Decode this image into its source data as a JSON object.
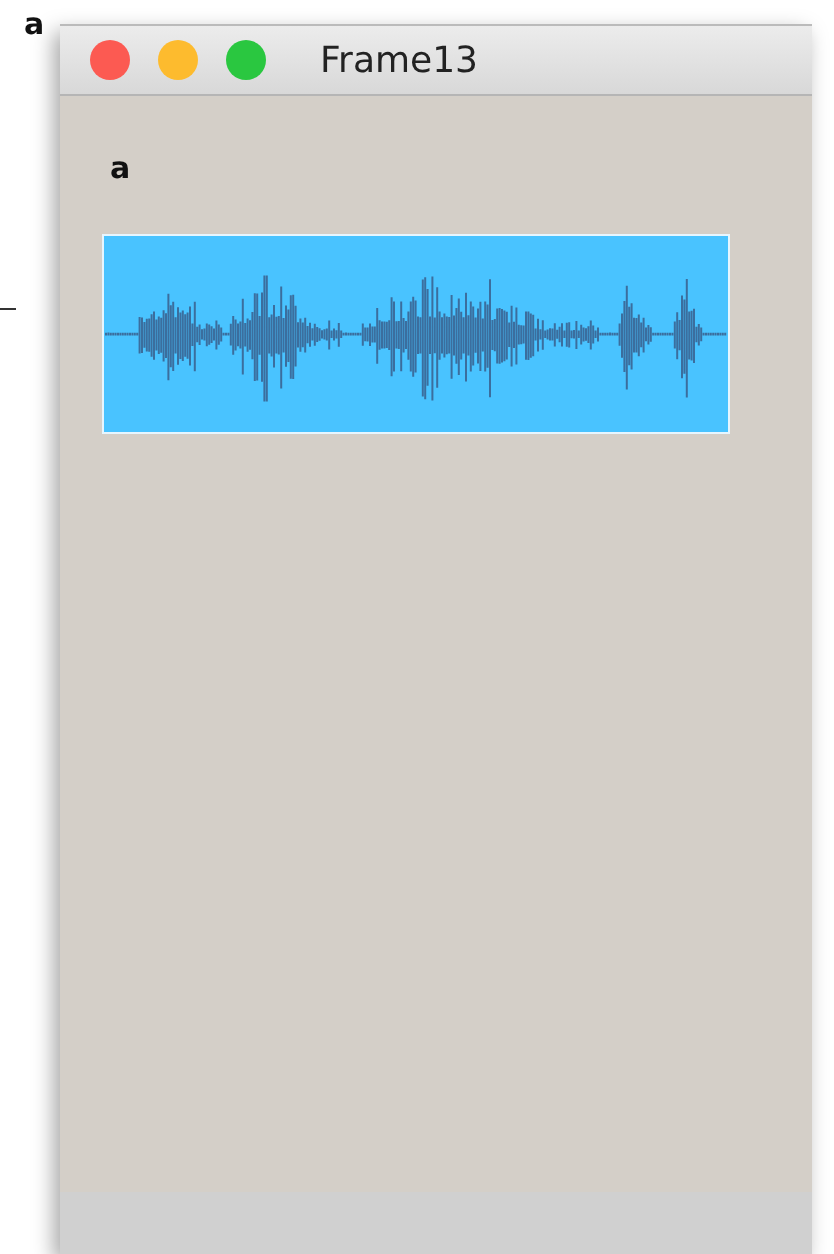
{
  "outside_label": "a",
  "window": {
    "title": "Frame13"
  },
  "label": "a",
  "waveform": {
    "kind": "audio"
  }
}
